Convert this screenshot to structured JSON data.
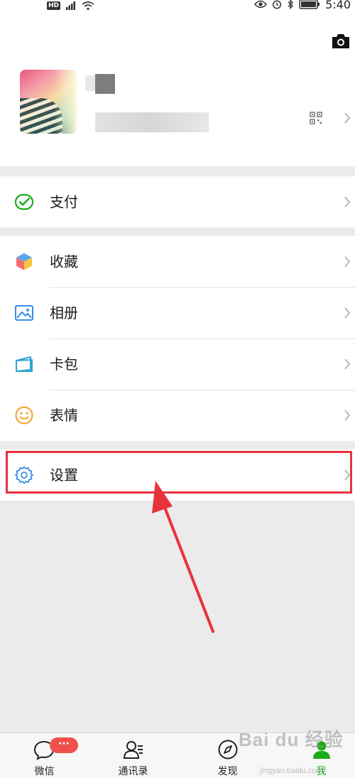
{
  "status_bar": {
    "hd": "HD",
    "time": "5:40"
  },
  "profile": {
    "icons": [
      "camera-icon",
      "qr-code-icon",
      "chevron-right-icon"
    ]
  },
  "menu": {
    "pay": "支付",
    "favorites": "收藏",
    "album": "相册",
    "cards": "卡包",
    "stickers": "表情",
    "settings": "设置"
  },
  "tabs": [
    {
      "label": "微信",
      "icon": "chat-bubble-icon",
      "badge": "···"
    },
    {
      "label": "通讯录",
      "icon": "contacts-icon"
    },
    {
      "label": "发现",
      "icon": "compass-icon"
    },
    {
      "label": "我",
      "icon": "person-icon",
      "active": true
    }
  ],
  "colors": {
    "accent_green": "#1aad19",
    "highlight_red": "#e8323c",
    "badge_red": "#f0504a",
    "background": "#ebebeb"
  },
  "watermark": {
    "brand": "Bai du 经验",
    "url": "jingyan.baidu.com"
  }
}
